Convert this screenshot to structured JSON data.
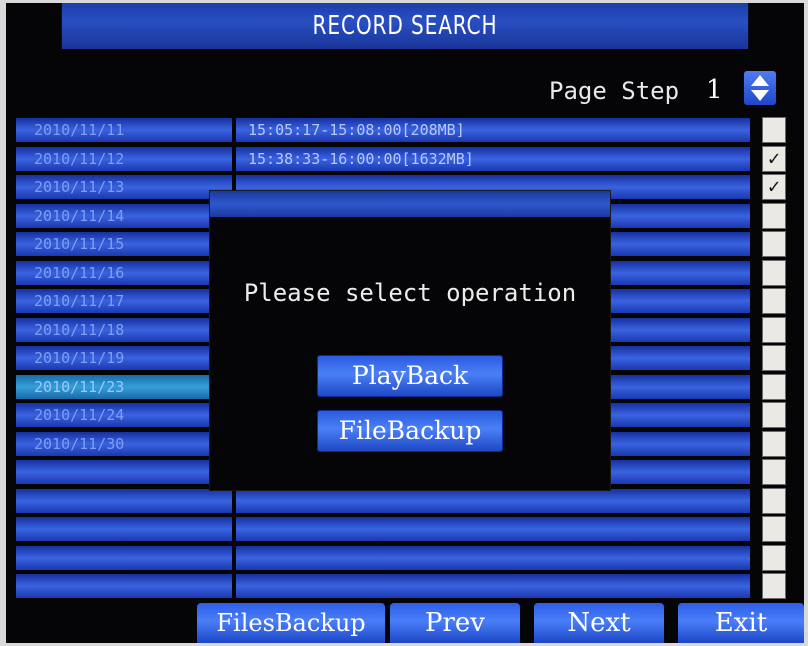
{
  "title": "RECORD SEARCH",
  "page_step": {
    "label": "Page Step",
    "value": "1"
  },
  "records": [
    {
      "date": "2010/11/11",
      "info": "15:05:17-15:08:00[208MB]",
      "checked": false,
      "highlighted": false
    },
    {
      "date": "2010/11/12",
      "info": "15:38:33-16:00:00[1632MB]",
      "checked": true,
      "highlighted": false
    },
    {
      "date": "2010/11/13",
      "info": "",
      "checked": true,
      "highlighted": false
    },
    {
      "date": "2010/11/14",
      "info": "",
      "checked": false,
      "highlighted": false
    },
    {
      "date": "2010/11/15",
      "info": "",
      "checked": false,
      "highlighted": false
    },
    {
      "date": "2010/11/16",
      "info": "",
      "checked": false,
      "highlighted": false
    },
    {
      "date": "2010/11/17",
      "info": "",
      "checked": false,
      "highlighted": false
    },
    {
      "date": "2010/11/18",
      "info": "",
      "checked": false,
      "highlighted": false
    },
    {
      "date": "2010/11/19",
      "info": "",
      "checked": false,
      "highlighted": false
    },
    {
      "date": "2010/11/23",
      "info": "",
      "checked": false,
      "highlighted": true
    },
    {
      "date": "2010/11/24",
      "info": "",
      "checked": false,
      "highlighted": false
    },
    {
      "date": "2010/11/30",
      "info": "",
      "checked": false,
      "highlighted": false
    },
    {
      "date": "",
      "info": "",
      "checked": false,
      "highlighted": false
    },
    {
      "date": "",
      "info": "",
      "checked": false,
      "highlighted": false
    },
    {
      "date": "",
      "info": "",
      "checked": false,
      "highlighted": false
    },
    {
      "date": "",
      "info": "",
      "checked": false,
      "highlighted": false
    },
    {
      "date": "",
      "info": "",
      "checked": false,
      "highlighted": false
    }
  ],
  "dialog": {
    "message": "Please select operation",
    "playback_label": "PlayBack",
    "filebackup_label": "FileBackup"
  },
  "bottom_bar": {
    "files_backup_label": "FilesBackup",
    "prev_label": "Prev",
    "next_label": "Next",
    "exit_label": "Exit"
  },
  "colors": {
    "title_bar": "#284fc2",
    "row_blue": "#3a63e0",
    "highlight_row": "#33a0d8",
    "background": "#050507"
  }
}
